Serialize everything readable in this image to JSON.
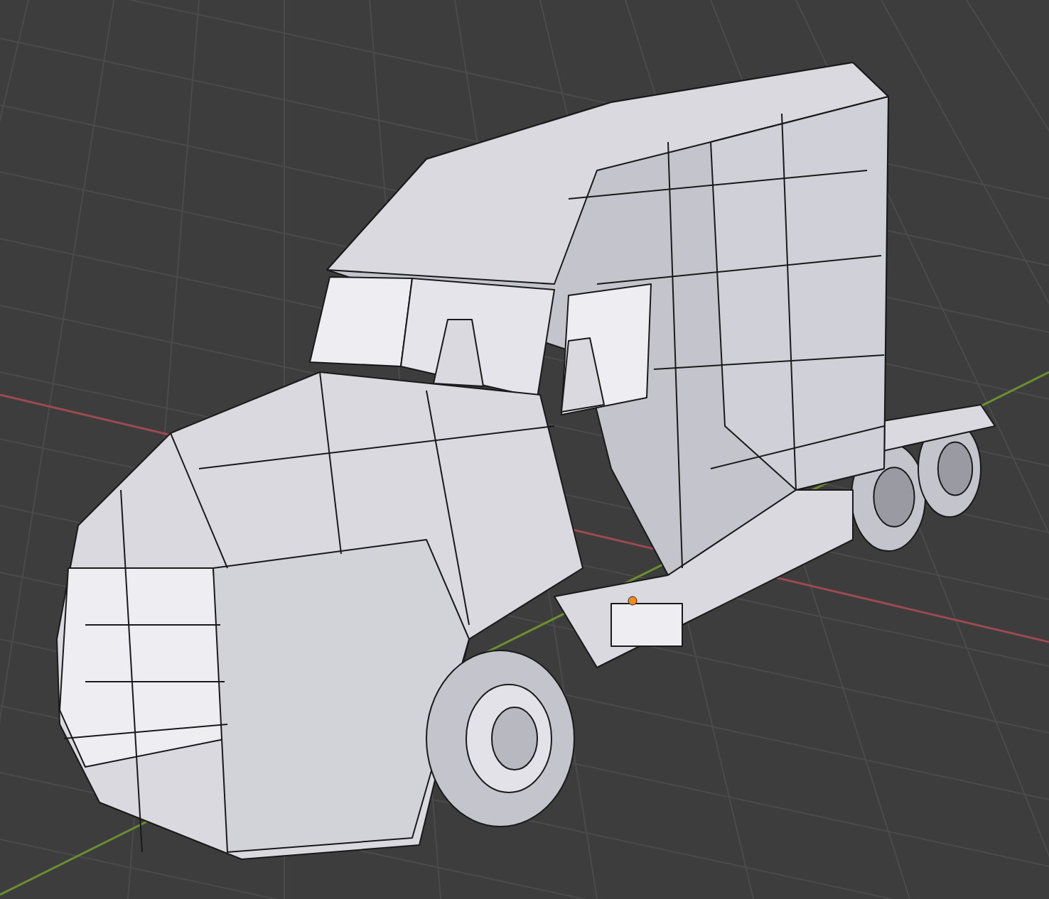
{
  "viewport": {
    "grid_floor": true,
    "axes": [
      {
        "kind": "x",
        "color": "#9a4a50"
      },
      {
        "kind": "y",
        "color": "#6b8f30"
      }
    ],
    "objects": [
      {
        "kind": "truck",
        "origin_shown": true
      }
    ]
  }
}
